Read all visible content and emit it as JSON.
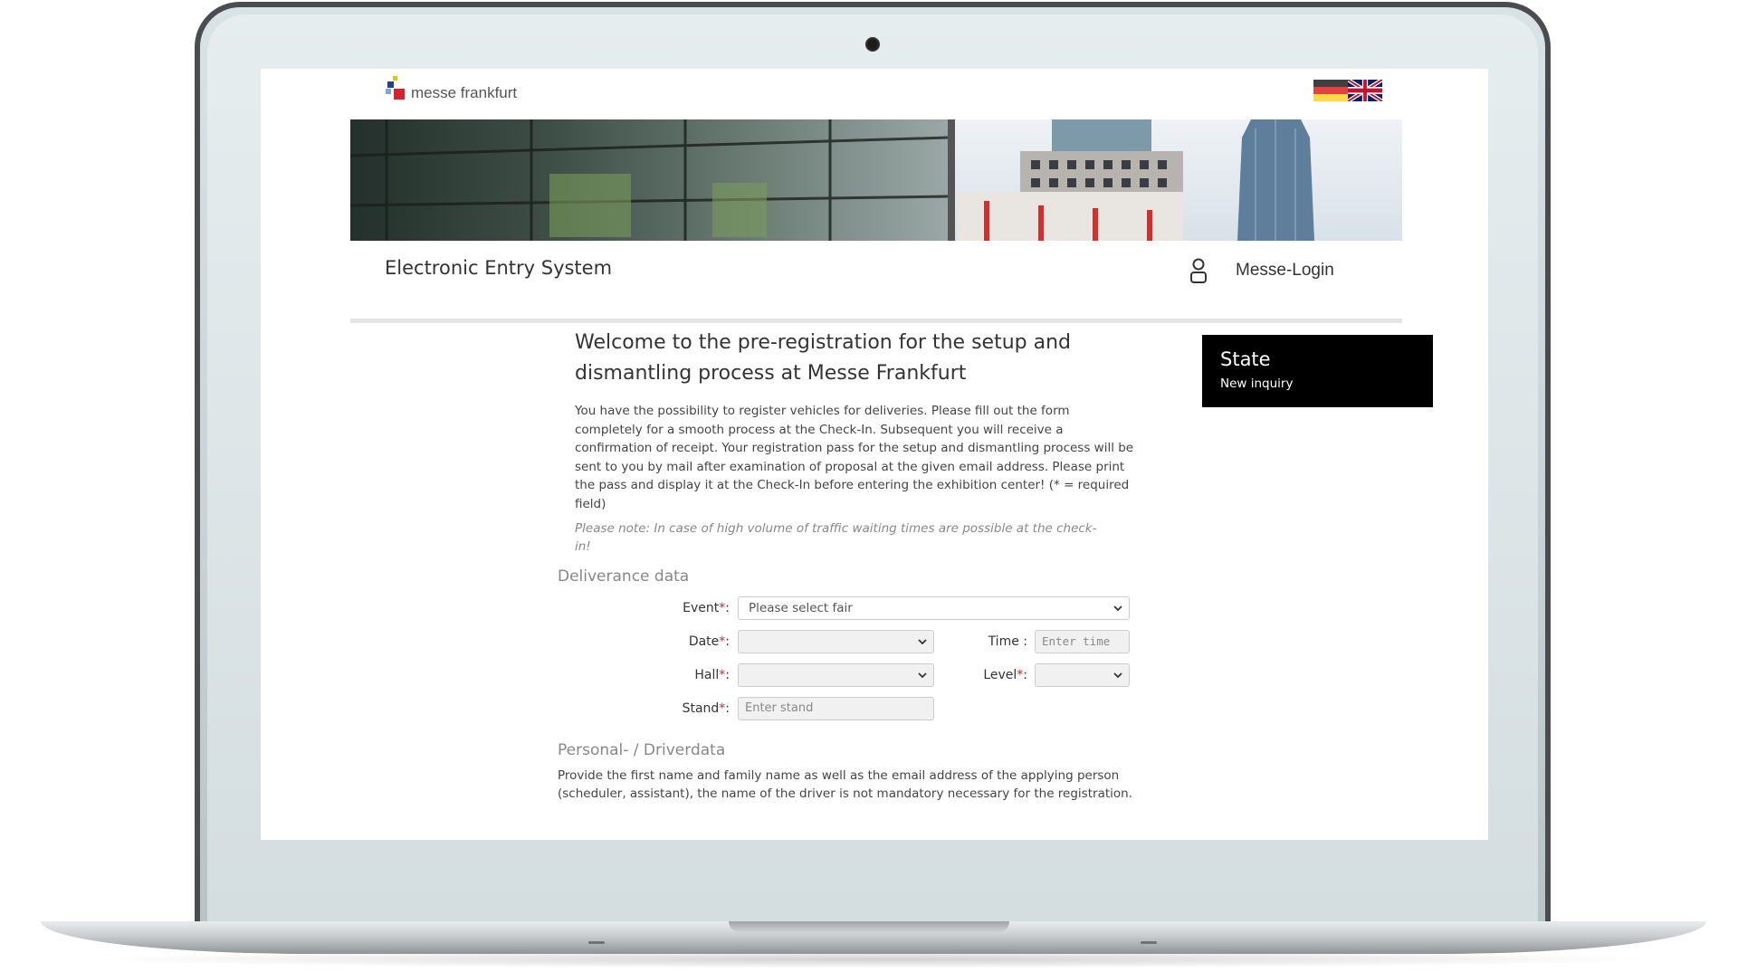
{
  "header": {
    "logo_text": "messe frankfurt",
    "languages": [
      "German",
      "English"
    ]
  },
  "titlebar": {
    "app_title": "Electronic Entry System",
    "login_label": "Messe-Login"
  },
  "intro": {
    "welcome": "Welcome to the pre-registration for the setup and dismantling process at Messe Frankfurt",
    "text": "You have the possibility to register vehicles for deliveries. Please fill out the form completely for a smooth process at the Check-In. Subsequent you will receive a confirmation of receipt. Your registration pass for the setup and dismantling process will be sent to you by mail after examination of proposal at the given email address. Please print the pass and display it at the Check-In before entering the exhibition center! (* = required field)",
    "note": "Please note: In case of high volume of traffic waiting times are possible at the check-in!"
  },
  "deliverance": {
    "title": "Deliverance data",
    "event_label": "Event",
    "event_value": "Please select fair",
    "date_label": "Date",
    "date_value": "",
    "time_label": "Time :",
    "time_placeholder": "Enter time",
    "hall_label": "Hall",
    "hall_value": "",
    "level_label": "Level",
    "level_value": "",
    "stand_label": "Stand",
    "stand_placeholder": "Enter stand",
    "required_mark": "*",
    "colon": ":"
  },
  "personal": {
    "title": "Personal- / Driverdata",
    "text": "Provide the first name and family name as well as the email address of the applying person (scheduler, assistant), the name of the driver is not mandatory necessary for the registration."
  },
  "state": {
    "title": "State",
    "value": "New inquiry"
  },
  "colors": {
    "required": "#d8232a",
    "state_bg": "#000000",
    "divider": "#e5e5e5"
  },
  "icons": [
    "user-icon",
    "chevron-down-icon",
    "flag-de-icon",
    "flag-uk-icon",
    "camera-icon"
  ]
}
